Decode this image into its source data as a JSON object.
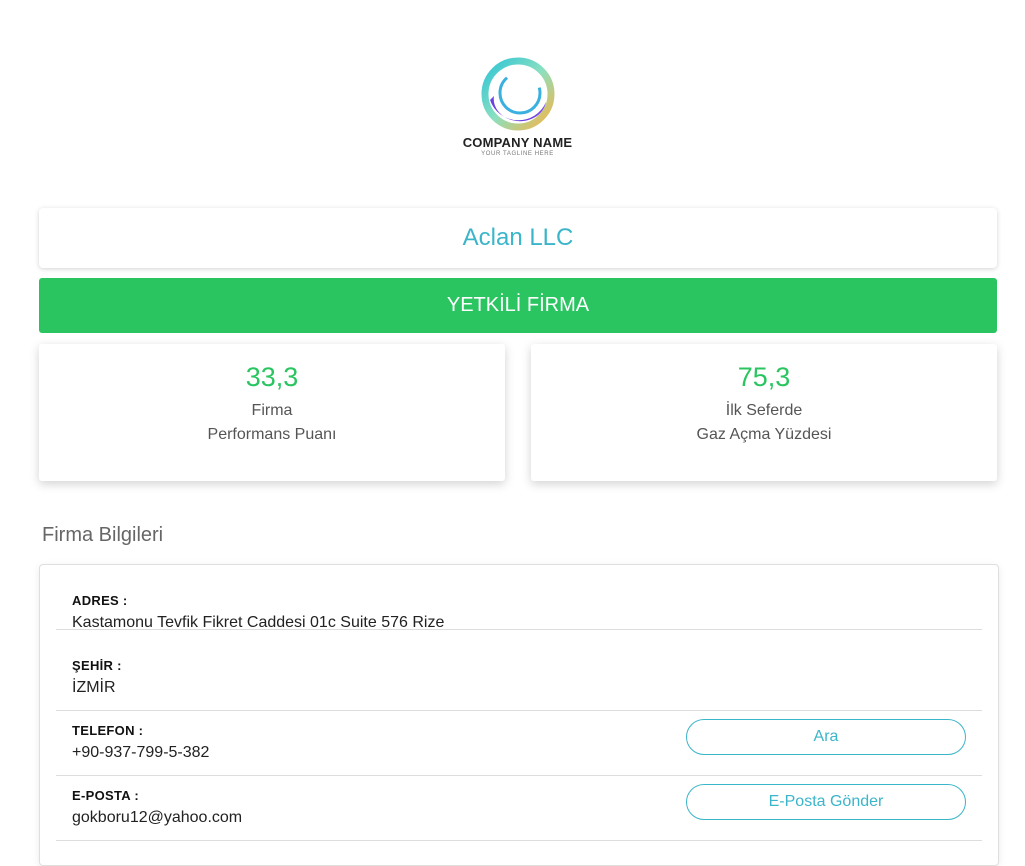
{
  "logo": {
    "name": "COMPANY NAME",
    "tagline": "YOUR TAGLINE HERE"
  },
  "company": {
    "name": "Aclan LLC"
  },
  "status": {
    "label": "YETKİLİ FİRMA"
  },
  "stats": [
    {
      "value": "33,3",
      "line1": "Firma",
      "line2": "Performans Puanı"
    },
    {
      "value": "75,3",
      "line1": "İlk Seferde",
      "line2": "Gaz Açma Yüzdesi"
    }
  ],
  "section": {
    "title": "Firma Bilgileri"
  },
  "info": {
    "address": {
      "label": "ADRES :",
      "value": "Kastamonu Tevfik Fikret Caddesi 01c Suite 576 Rize"
    },
    "city": {
      "label": "ŞEHİR :",
      "value": "İZMİR"
    },
    "phone": {
      "label": "TELEFON :",
      "value": "+90-937-799-5-382",
      "button": "Ara"
    },
    "email": {
      "label": "E-POSTA :",
      "value": "gokboru12@yahoo.com",
      "button": "E-Posta Gönder"
    }
  },
  "colors": {
    "accent": "#3bb5c9",
    "success": "#2ac561"
  }
}
